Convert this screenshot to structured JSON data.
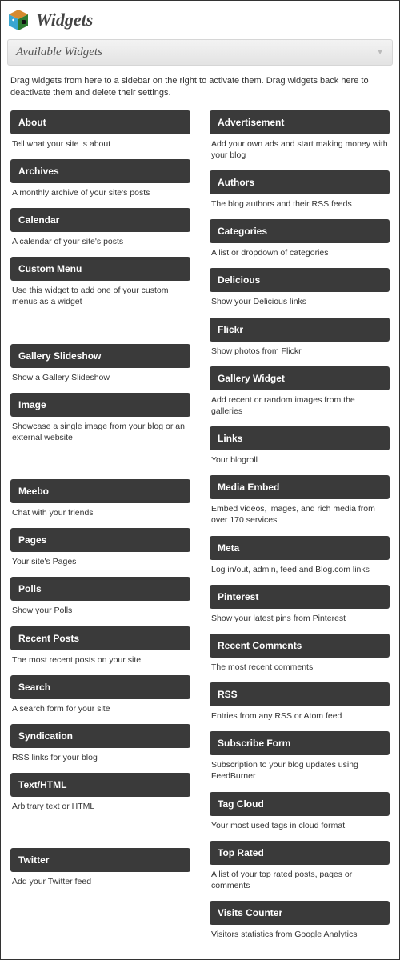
{
  "header": {
    "title": "Widgets"
  },
  "section": {
    "title": "Available Widgets",
    "instructions": "Drag widgets from here to a sidebar on the right to activate them. Drag widgets back here to deactivate them and delete their settings."
  },
  "widgets": {
    "left": [
      {
        "title": "About",
        "desc": "Tell what your site is about"
      },
      {
        "title": "Archives",
        "desc": "A monthly archive of your site's posts"
      },
      {
        "title": "Calendar",
        "desc": "A calendar of your site's posts"
      },
      {
        "title": "Custom Menu",
        "desc": "Use this widget to add one of your custom menus as a widget"
      },
      {
        "title": "",
        "desc": ""
      },
      {
        "title": "Gallery Slideshow",
        "desc": "Show a Gallery Slideshow"
      },
      {
        "title": "Image",
        "desc": "Showcase a single image from your blog or an external website"
      },
      {
        "title": "",
        "desc": ""
      },
      {
        "title": "Meebo",
        "desc": "Chat with your friends"
      },
      {
        "title": "Pages",
        "desc": "Your site's Pages"
      },
      {
        "title": "Polls",
        "desc": "Show your Polls"
      },
      {
        "title": "Recent Posts",
        "desc": "The most recent posts on your site"
      },
      {
        "title": "Search",
        "desc": "A search form for your site"
      },
      {
        "title": "Syndication",
        "desc": "RSS links for your blog"
      },
      {
        "title": "Text/HTML",
        "desc": "Arbitrary text or HTML"
      },
      {
        "title": "",
        "desc": ""
      },
      {
        "title": "Twitter",
        "desc": "Add your Twitter feed"
      }
    ],
    "right": [
      {
        "title": "Advertisement",
        "desc": "Add your own ads and start making money with your blog"
      },
      {
        "title": "Authors",
        "desc": "The blog authors and their RSS feeds"
      },
      {
        "title": "Categories",
        "desc": "A list or dropdown of categories"
      },
      {
        "title": "Delicious",
        "desc": "Show your Delicious links"
      },
      {
        "title": "Flickr",
        "desc": "Show photos from Flickr"
      },
      {
        "title": "Gallery Widget",
        "desc": "Add recent or random images from the galleries"
      },
      {
        "title": "Links",
        "desc": "Your blogroll"
      },
      {
        "title": "Media Embed",
        "desc": "Embed videos, images, and rich media from over 170 services"
      },
      {
        "title": "Meta",
        "desc": "Log in/out, admin, feed and Blog.com links"
      },
      {
        "title": "Pinterest",
        "desc": "Show your latest pins from Pinterest"
      },
      {
        "title": "Recent Comments",
        "desc": "The most recent comments"
      },
      {
        "title": "RSS",
        "desc": "Entries from any RSS or Atom feed"
      },
      {
        "title": "Subscribe Form",
        "desc": "Subscription to your blog updates using FeedBurner"
      },
      {
        "title": "Tag Cloud",
        "desc": "Your most used tags in cloud format"
      },
      {
        "title": "Top Rated",
        "desc": "A list of your top rated posts, pages or comments"
      },
      {
        "title": "Visits Counter",
        "desc": "Visitors statistics from Google Analytics"
      }
    ]
  }
}
